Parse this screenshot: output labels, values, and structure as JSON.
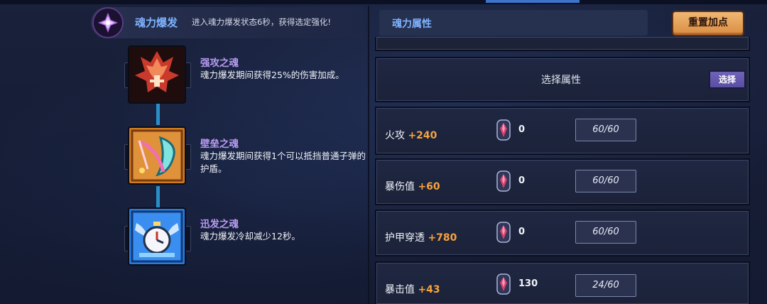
{
  "header": {
    "title": "魂力爆发",
    "description": "进入魂力爆发状态6秒，获得选定强化!"
  },
  "skills": [
    {
      "name": "强攻之魂",
      "description": "魂力爆发期间获得25%的伤害加成。",
      "icon": "red-warrior-icon"
    },
    {
      "name": "壁垒之魂",
      "description": "魂力爆发期间获得1个可以抵挡普通子弹的护盾。",
      "icon": "shield-bow-icon"
    },
    {
      "name": "迅发之魂",
      "description": "魂力爆发冷却减少12秒。",
      "icon": "winged-clock-icon"
    }
  ],
  "panel": {
    "title": "魂力属性",
    "reset_label": "重置加点",
    "select_label": "选择属性",
    "select_button": "选择"
  },
  "attributes": [
    {
      "name": "火攻",
      "bonus": "+240",
      "gem_count": "0",
      "cap": "60/60"
    },
    {
      "name": "暴伤值",
      "bonus": "+60",
      "gem_count": "0",
      "cap": "60/60"
    },
    {
      "name": "护甲穿透",
      "bonus": "+780",
      "gem_count": "0",
      "cap": "60/60"
    },
    {
      "name": "暴击值",
      "bonus": "+43",
      "gem_count": "130",
      "cap": "24/60"
    }
  ],
  "colors": {
    "accent_blue": "#7fb3ff",
    "skill_name": "#b79cf2",
    "bonus_orange": "#f7a23c",
    "reset_button": "#e6a05a",
    "select_button": "#6358ad"
  }
}
